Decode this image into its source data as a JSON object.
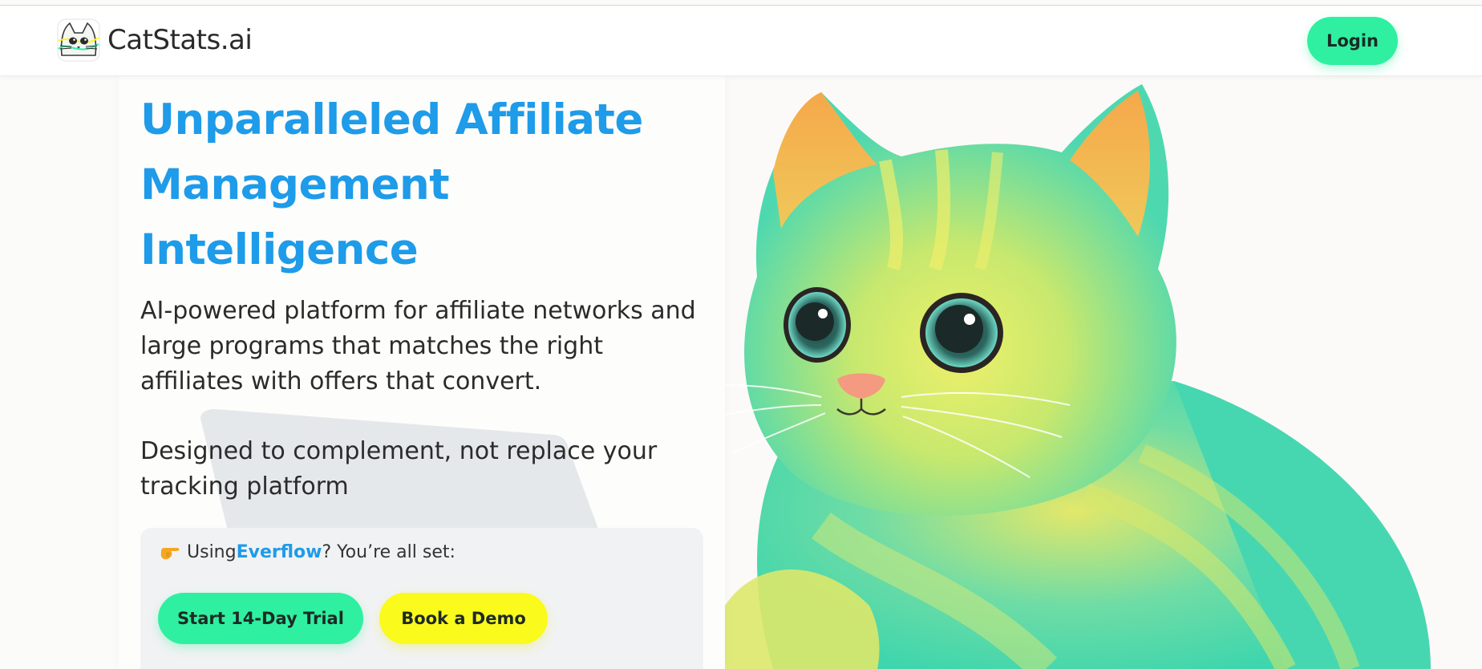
{
  "header": {
    "brand_name": "CatStats.ai",
    "logo_icon": "cat-face-logo-icon",
    "login_label": "Login"
  },
  "hero": {
    "title": "Unparalleled Affiliate Management Intelligence",
    "description": "AI-powered platform for affiliate networks and large programs that matches the right affiliates with offers that convert.",
    "subdescription": "Designed to complement, not replace your tracking platform",
    "image_icon": "green-cat-illustration"
  },
  "cta": {
    "pointer_icon": "pointing-hand-icon",
    "prefix": "Using ",
    "highlight": "Everflow",
    "suffix": "? You’re all set:",
    "trial_label": "Start 14-Day Trial",
    "demo_label": "Book a Demo"
  },
  "colors": {
    "accent_blue": "#1e9be9",
    "accent_green": "#2ef0a0",
    "accent_yellow": "#fafa1c"
  }
}
